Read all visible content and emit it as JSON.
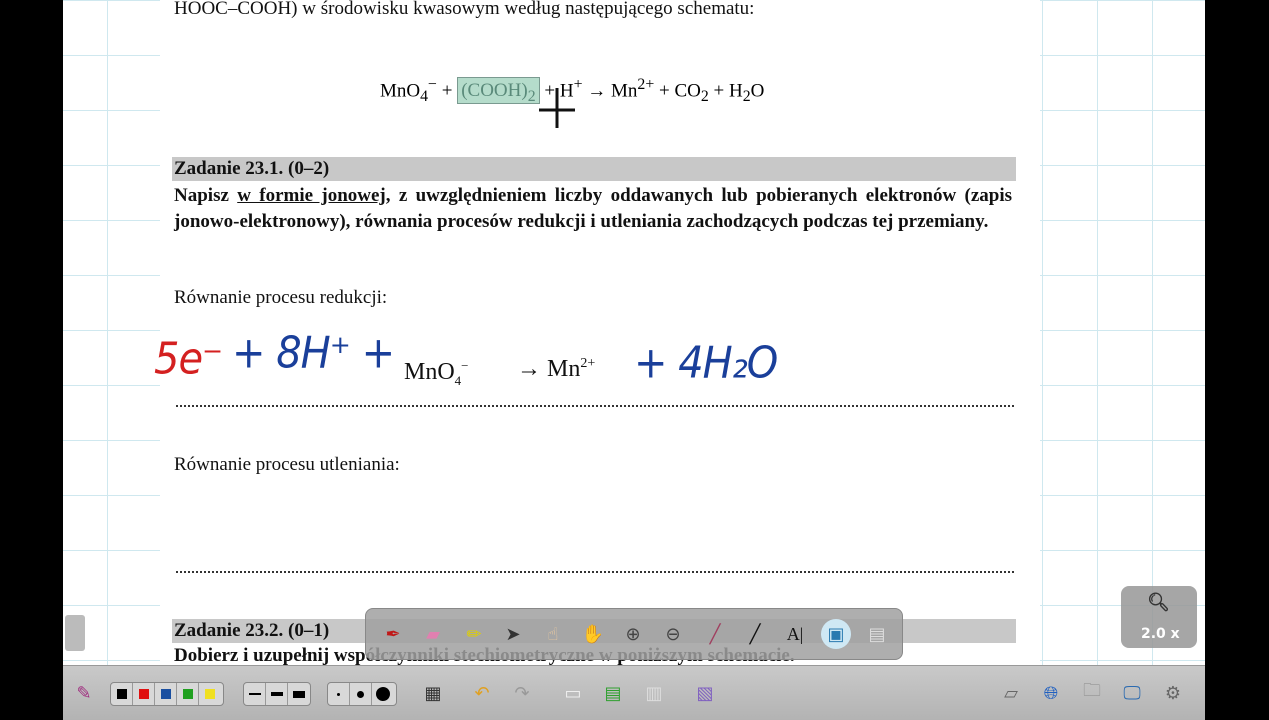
{
  "document": {
    "intro_line": "HOOC–COOH) w środowisku kwasowym według następującego schematu:",
    "equation": {
      "part1": "MnO",
      "sub1": "4",
      "sup1": "−",
      "plus1": " + ",
      "highlighted": "(COOH)",
      "hl_sub": "2",
      "rest": " + H",
      "sup2": "+",
      "rest2": " → Mn",
      "sup3": "2+",
      "rest3": " + CO",
      "sub3": "2",
      "rest4": " + H",
      "sub4": "2",
      "rest5": "O"
    },
    "task1_header": "Zadanie 23.1. (0–2)",
    "task1_text_pre": "Napisz ",
    "task1_text_underline": "w formie jonowej",
    "task1_text_post": ", z uwzględnieniem liczby oddawanych lub pobieranych elektronów (zapis jonowo-elektronowy), równania procesów redukcji i utleniania zachodzących podczas tej przemiany.",
    "reduction_label": "Równanie procesu redukcji:",
    "reduction_printed": {
      "left": "MnO",
      "left_sub": "4",
      "left_sup": "−",
      "arrow": "→ Mn",
      "right_sup": "2+"
    },
    "handwriting": {
      "red": "5e⁻",
      "blue_left": "+ 8H⁺ +",
      "blue_right": "+ 4H₂O"
    },
    "oxidation_label": "Równanie procesu utleniania:",
    "task2_header": "Zadanie 23.2. (0–1)",
    "task2_text": "Dobierz i uzupełnij współczynniki stechiometryczne w poniższym schemacie."
  },
  "zoom": {
    "level": "2.0 x"
  },
  "colors": {
    "ink_red": "#d42020",
    "ink_blue": "#1a3f9a",
    "highlight": "#b5dccb",
    "palette": [
      "#000000",
      "#e01010",
      "#1a4fa0",
      "#20a020",
      "#f0e020"
    ]
  }
}
